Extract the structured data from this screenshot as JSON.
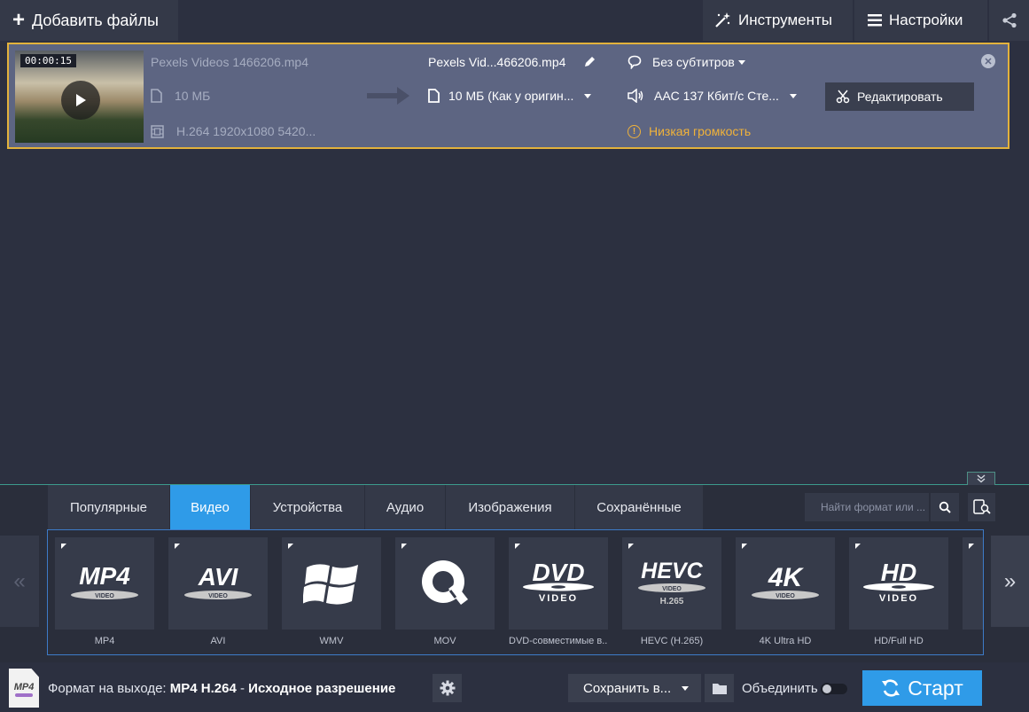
{
  "toolbar": {
    "add_files": "Добавить файлы",
    "tools": "Инструменты",
    "settings": "Настройки"
  },
  "file": {
    "timestamp": "00:00:15",
    "source_name": "Pexels Videos 1466206.mp4",
    "source_size": "10 МБ",
    "source_codec": "H.264 1920x1080 5420...",
    "output_name": "Pexels Vid...466206.mp4",
    "output_size": "10 МБ (Как у оригин...",
    "subtitles": "Без субтитров",
    "audio": "AAC 137 Кбит/с Сте...",
    "warning": "Низкая громкость",
    "edit_button": "Редактировать",
    "warning_color": "#f0b23a",
    "selection_color": "#e3b23c"
  },
  "tabs": [
    {
      "label": "Популярные",
      "active": false
    },
    {
      "label": "Видео",
      "active": true
    },
    {
      "label": "Устройства",
      "active": false
    },
    {
      "label": "Аудио",
      "active": false
    },
    {
      "label": "Изображения",
      "active": false
    },
    {
      "label": "Сохранённые",
      "active": false
    }
  ],
  "search": {
    "placeholder": "Найти формат или ..."
  },
  "nav": {
    "prev": "«",
    "next": "»"
  },
  "formats": [
    {
      "label": "MP4",
      "icon": "mp4-video-icon",
      "logo": "MP4",
      "sub": "VIDEO"
    },
    {
      "label": "AVI",
      "icon": "avi-video-icon",
      "logo": "AVI",
      "sub": "VIDEO"
    },
    {
      "label": "WMV",
      "icon": "windows-logo-icon",
      "logo": "",
      "sub": ""
    },
    {
      "label": "MOV",
      "icon": "quicktime-logo-icon",
      "logo": "",
      "sub": ""
    },
    {
      "label": "DVD-совместимые в...",
      "icon": "dvd-video-icon",
      "logo": "DVD",
      "sub": "VIDEO"
    },
    {
      "label": "HEVC (H.265)",
      "icon": "hevc-video-icon",
      "logo": "HEVC",
      "sub": "VIDEO"
    },
    {
      "label": "4K Ultra HD",
      "icon": "4k-video-icon",
      "logo": "4K",
      "sub": "VIDEO"
    },
    {
      "label": "HD/Full HD",
      "icon": "hd-video-icon",
      "logo": "HD",
      "sub": "VIDEO"
    }
  ],
  "bottom": {
    "file_icon_text": "MP4",
    "format_prefix": "Формат на выходе: ",
    "format_value": "MP4 H.264",
    "format_sep": " - ",
    "format_resolution": "Исходное разрешение",
    "save_to": "Сохранить в...",
    "merge": "Объединить",
    "start": "Старт",
    "accent": "#2f9be8"
  }
}
